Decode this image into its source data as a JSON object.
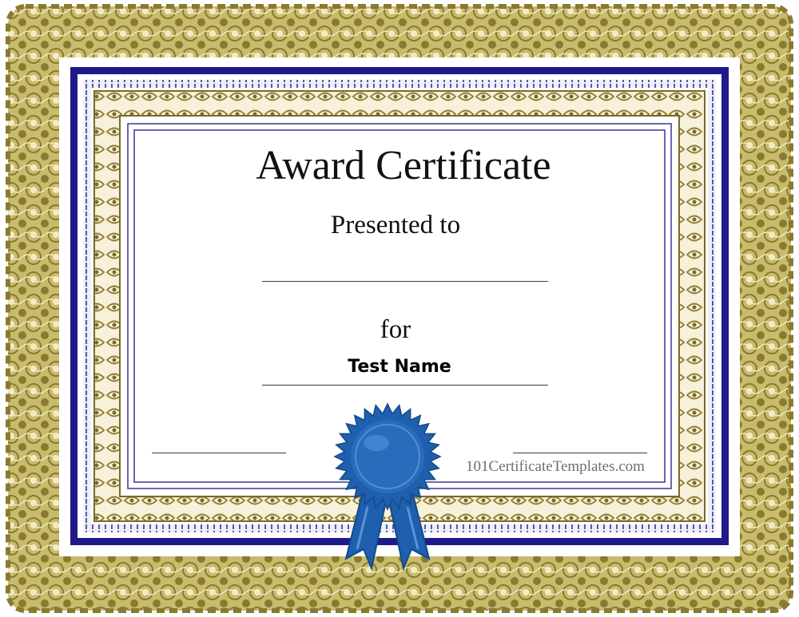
{
  "certificate": {
    "title": "Award Certificate",
    "presented_to": "Presented to",
    "for_label": "for",
    "recipient_name": "Test Name",
    "watermark": "101CertificateTemplates.com"
  },
  "colors": {
    "gold_border": "#9a8a3a",
    "gold_light": "#d9d0a0",
    "navy_band": "#1f1a8a",
    "ribbon_blue": "#1e5fae",
    "ribbon_dark": "#154a8a"
  },
  "icons": {
    "seal": "award-rosette-icon"
  }
}
